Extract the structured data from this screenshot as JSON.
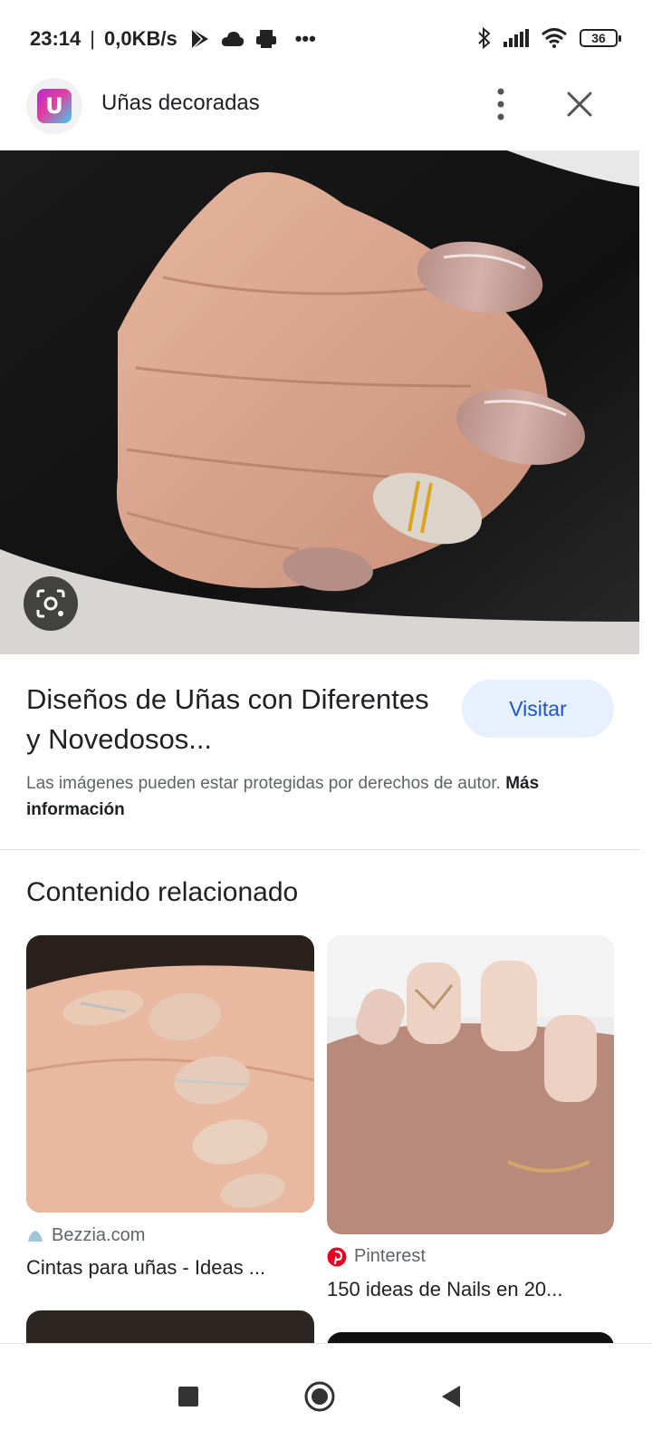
{
  "status_bar": {
    "time": "23:14",
    "separator": "|",
    "net_speed": "0,0KB/s",
    "more": "•••",
    "battery": "36",
    "icons": [
      "play-store-icon",
      "cloud-icon",
      "printer-icon",
      "bluetooth-icon",
      "signal-icon",
      "wifi-icon",
      "battery-icon"
    ]
  },
  "header": {
    "logo_letter": "U",
    "title": "Uñas decoradas"
  },
  "result": {
    "title": "Diseños de Uñas con Diferentes y Novedosos...",
    "visit_label": "Visitar",
    "copyright_text": "Las imágenes pueden estar protegidas por derechos de autor.",
    "more_info_label": "Más información"
  },
  "related": {
    "section_title": "Contenido relacionado",
    "cards": [
      {
        "source": "Bezzia.com",
        "title": "Cintas para uñas - Ideas ..."
      },
      {
        "source": "Pinterest",
        "title": "150 ideas de Nails en 20..."
      }
    ]
  },
  "colors": {
    "visit_bg": "#e8f0fe",
    "visit_text": "#1a56c4",
    "pinterest": "#e60023",
    "nail_nude": "#c8a49a"
  }
}
